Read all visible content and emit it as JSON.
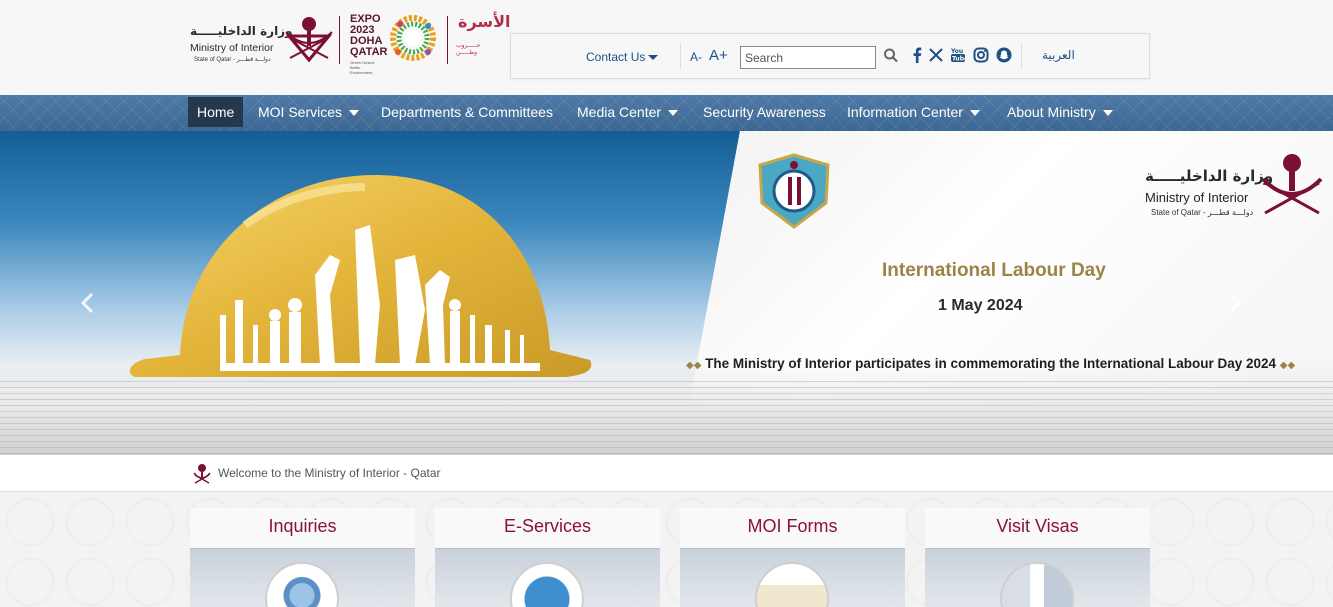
{
  "header": {
    "moi_logo": {
      "arabic": "وزارة الداخليـــــة",
      "english": "Ministry of Interior",
      "state": "State of Qatar - دولـــة قطـــر"
    },
    "expo_logo": {
      "text": "EXPO 2023 DOHA QATAR",
      "subtext": "Green Desert, Better Environment"
    },
    "alasra_logo": {
      "arabic": "الأسرة",
      "subtext": "حـــــروب وطـــــن"
    },
    "toolbar": {
      "contact_label": "Contact Us",
      "font_smaller": "A-",
      "font_larger": "A+",
      "search_placeholder": "Search",
      "social_icons": [
        "facebook-icon",
        "x-icon",
        "youtube-icon",
        "instagram-icon",
        "snapchat-icon"
      ],
      "language_link": "العربية"
    }
  },
  "nav": {
    "items": [
      {
        "label": "Home",
        "active": true,
        "dropdown": false
      },
      {
        "label": "MOI Services",
        "active": false,
        "dropdown": true
      },
      {
        "label": "Departments & Committees",
        "active": false,
        "dropdown": false
      },
      {
        "label": "Media Center",
        "active": false,
        "dropdown": true
      },
      {
        "label": "Security Awareness",
        "active": false,
        "dropdown": false
      },
      {
        "label": "Information Center",
        "active": false,
        "dropdown": true
      },
      {
        "label": "About Ministry",
        "active": false,
        "dropdown": true
      }
    ]
  },
  "slider": {
    "moi_logo": {
      "arabic": "وزارة الداخليـــــة",
      "english": "Ministry of Interior",
      "state": "State of Qatar - دولـــة قطـــر"
    },
    "title": "International Labour Day",
    "date": "1 May 2024",
    "caption": "The Ministry of Interior participates in commemorating the International Labour Day 2024",
    "prev_icon": "chevron-left-icon",
    "next_icon": "chevron-right-icon"
  },
  "welcome": {
    "text": "Welcome to the Ministry of Interior - Qatar"
  },
  "cards": [
    {
      "title": "Inquiries"
    },
    {
      "title": "E-Services"
    },
    {
      "title": "MOI Forms"
    },
    {
      "title": "Visit Visas"
    }
  ],
  "colors": {
    "brand_maroon": "#8c1238",
    "nav_blue": "#3d6793",
    "link_blue": "#1f4f86",
    "gold": "#9c8447"
  }
}
